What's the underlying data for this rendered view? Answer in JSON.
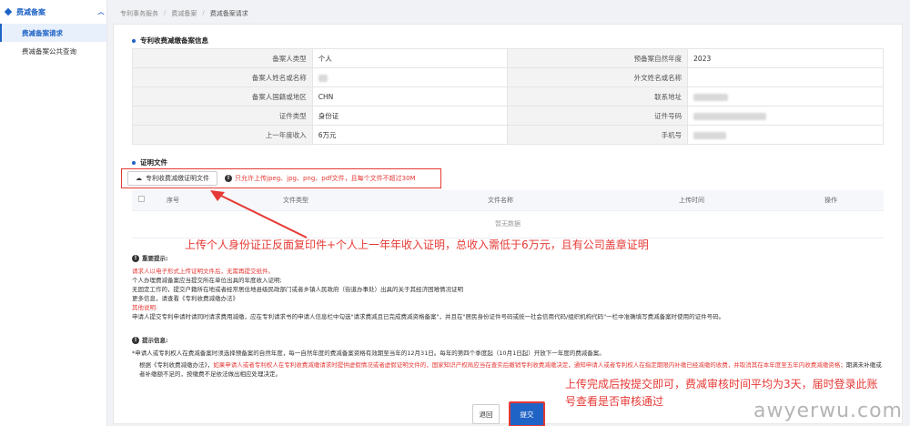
{
  "sidebar": {
    "group_label": "费减备案",
    "items": [
      {
        "label": "费减备案请求",
        "active": true
      },
      {
        "label": "费减备案公共查询",
        "active": false
      }
    ]
  },
  "breadcrumb": [
    "专利事务服务",
    "费减备案",
    "费减备案请求"
  ],
  "info_section": {
    "title": "专利收费减缴备案信息",
    "rows": [
      {
        "k1": "备案人类型",
        "v1": "个人",
        "k2": "预备案自然年度",
        "v2": "2023"
      },
      {
        "k1": "备案人姓名或名称",
        "v1": "",
        "k2": "外文姓名或名称",
        "v2": ""
      },
      {
        "k1": "备案人国籍或地区",
        "v1": "CHN",
        "k2": "联系地址",
        "v2": ""
      },
      {
        "k1": "证件类型",
        "v1": "身份证",
        "k2": "证件号码",
        "v2": ""
      },
      {
        "k1": "上一年度收入",
        "v1": "6万元",
        "k2": "手机号",
        "v2": ""
      }
    ]
  },
  "files_section": {
    "title": "证明文件",
    "upload_button": "专利收费减缴证明文件",
    "upload_tip": "只允许上传jpeg、jpg、png、pdf文件，且每个文件不超过30M",
    "columns": [
      "序号",
      "文件类型",
      "文件名称",
      "上传时间",
      "操作"
    ],
    "empty_text": "暂无数据"
  },
  "annotation_upload": "上传个人身份证正反面复印件+个人上一年年收入证明，总收入需低于6万元，且有公司盖章证明",
  "important": {
    "title": "重要提示:",
    "lines": [
      {
        "text": "请求人以电子形式上传证明文件后，无需再提交纸件。",
        "red": true
      },
      {
        "text": "个人办理费减备案应当提交所在单位出具的年度收入证明;",
        "red": false
      },
      {
        "text": "无固定工作的，提交户籍所在地或者经常居住地县级民政部门或者乡镇人民政府（街道办事处）出具的关于其经济困难情况证明",
        "red": false
      },
      {
        "text": "更多信息，请查看《专利收费减缴办法》",
        "red": false
      },
      {
        "text": "其他说明:",
        "red": true
      },
      {
        "text": "申请人提交专利申请时请同时请求费用减缴，应在专利请求书的申请人信息栏中勾选\"请求费减且已完成费减资格备案\"，并且在\"居民身份证件号码或统一社会信用代码/组织机构代码\"一栏中准确填写费减备案时使用的证件号码。",
        "red": false
      }
    ]
  },
  "tips": {
    "title": "提示信息:",
    "line1": "*申请人或专利权人在费减备案时须选择预备案的自然年度，每一自然年度的费减备案资格有效期至当年的12月31日。每年的第四个季度起（10月1日起）开放下一年度的费减备案。",
    "line2_pre": "根据《专利收费减缴办法》，",
    "line2_red": "如果申请人或者专利权人在专利收费减缴请求时提供虚假情况或者虚假证明文件的，国家知识产权局应当在查实后撤销专利收费减缴决定，通知申请人或者专利权人在指定期限内补缴已经减缴的收费，并取消其在本年度至五年内收费减缴资格；",
    "line2_post": "期满未补缴或者补缴额不足的，按缴费不足依法做出相应处理决定。"
  },
  "annotation_submit_1": "上传完成后按提交即可，费减审核时间平均为3天，届时登录此账",
  "annotation_submit_2": "号查看是否审核通过",
  "buttons": {
    "back": "退回",
    "submit": "提交"
  },
  "watermark": "awyerwu.com"
}
